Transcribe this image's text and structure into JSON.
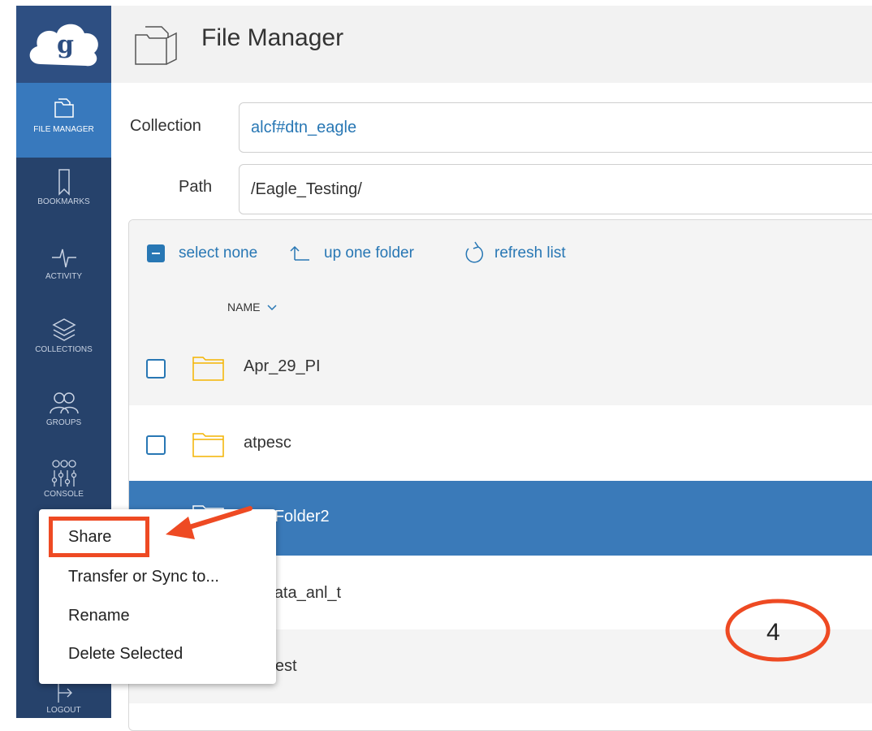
{
  "app": {
    "title": "File Manager"
  },
  "sidebar": {
    "logo": "globus-logo",
    "items": [
      {
        "label": "FILE MANAGER",
        "icon": "folder-icon",
        "active": true
      },
      {
        "label": "BOOKMARKS",
        "icon": "bookmark-icon",
        "active": false
      },
      {
        "label": "ACTIVITY",
        "icon": "pulse-icon",
        "active": false
      },
      {
        "label": "COLLECTIONS",
        "icon": "layers-icon",
        "active": false
      },
      {
        "label": "GROUPS",
        "icon": "people-icon",
        "active": false
      },
      {
        "label": "CONSOLE",
        "icon": "sliders-icon",
        "active": false
      },
      {
        "label": "LOGOUT",
        "icon": "logout-icon",
        "active": false
      }
    ]
  },
  "form": {
    "collection_label": "Collection",
    "collection_value": "alcf#dtn_eagle",
    "path_label": "Path",
    "path_value": "/Eagle_Testing/"
  },
  "toolbar": {
    "select_none": "select none",
    "up_one_folder": "up one folder",
    "refresh_list": "refresh list"
  },
  "list": {
    "column_name": "NAME",
    "rows": [
      {
        "name": "Apr_29_PI",
        "selected": false
      },
      {
        "name": "atpesc",
        "selected": false
      },
      {
        "name": "lab_Folder2",
        "selected": true
      },
      {
        "name": "id_data_anl_t",
        "selected": false
      },
      {
        "name": "ha_test",
        "selected": false
      }
    ]
  },
  "context_menu": {
    "items": [
      "Share",
      "Transfer or Sync to...",
      "Rename",
      "Delete Selected"
    ]
  },
  "annotation": {
    "step_number": "4",
    "highlight_color": "#ee4a23"
  },
  "colors": {
    "sidebar": "#26426b",
    "active_nav": "#3879bd",
    "link": "#2877b4",
    "selected_row": "#3a7ab9",
    "folder": "#f4b400"
  }
}
